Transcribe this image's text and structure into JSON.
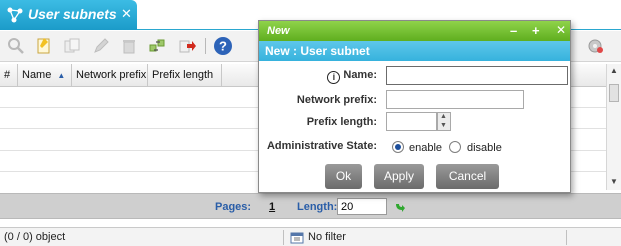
{
  "tab": {
    "title": "User subnets",
    "close_glyph": "✕"
  },
  "toolbar": {
    "icons": [
      "magnifier-icon",
      "new-document-icon",
      "copy-icon",
      "edit-pencil-icon",
      "delete-trash-icon",
      "refresh-arrows-icon",
      "export-icon",
      "help-icon",
      "settings-icon"
    ]
  },
  "grid": {
    "columns": [
      "#",
      "Name",
      "Network prefix",
      "Prefix length"
    ],
    "sort_indicator": "▲"
  },
  "pager": {
    "pages_label": "Pages:",
    "page_number": "1",
    "length_label": "Length:",
    "length_value": "20"
  },
  "status": {
    "count_text": "(0 / 0) object",
    "filter_text": "No filter"
  },
  "dialog": {
    "title": "New",
    "subtitle": "New : User subnet",
    "controls": {
      "minimize": "–",
      "maximize": "+",
      "close": "✕"
    },
    "fields": {
      "name_label": "Name:",
      "name_value": "",
      "network_prefix_label": "Network prefix:",
      "network_prefix_value": "",
      "prefix_length_label": "Prefix length:",
      "prefix_length_value": "",
      "admin_state_label": "Administrative State:",
      "enable_label": "enable",
      "disable_label": "disable",
      "admin_state_selected": "enable"
    },
    "buttons": {
      "ok": "Ok",
      "apply": "Apply",
      "cancel": "Cancel"
    }
  },
  "colors": {
    "tab_blue": "#2aa7cf",
    "dialog_green": "#6fbf2a",
    "subtitle_blue": "#42b9e2",
    "pager_link": "#2a5ea8"
  }
}
